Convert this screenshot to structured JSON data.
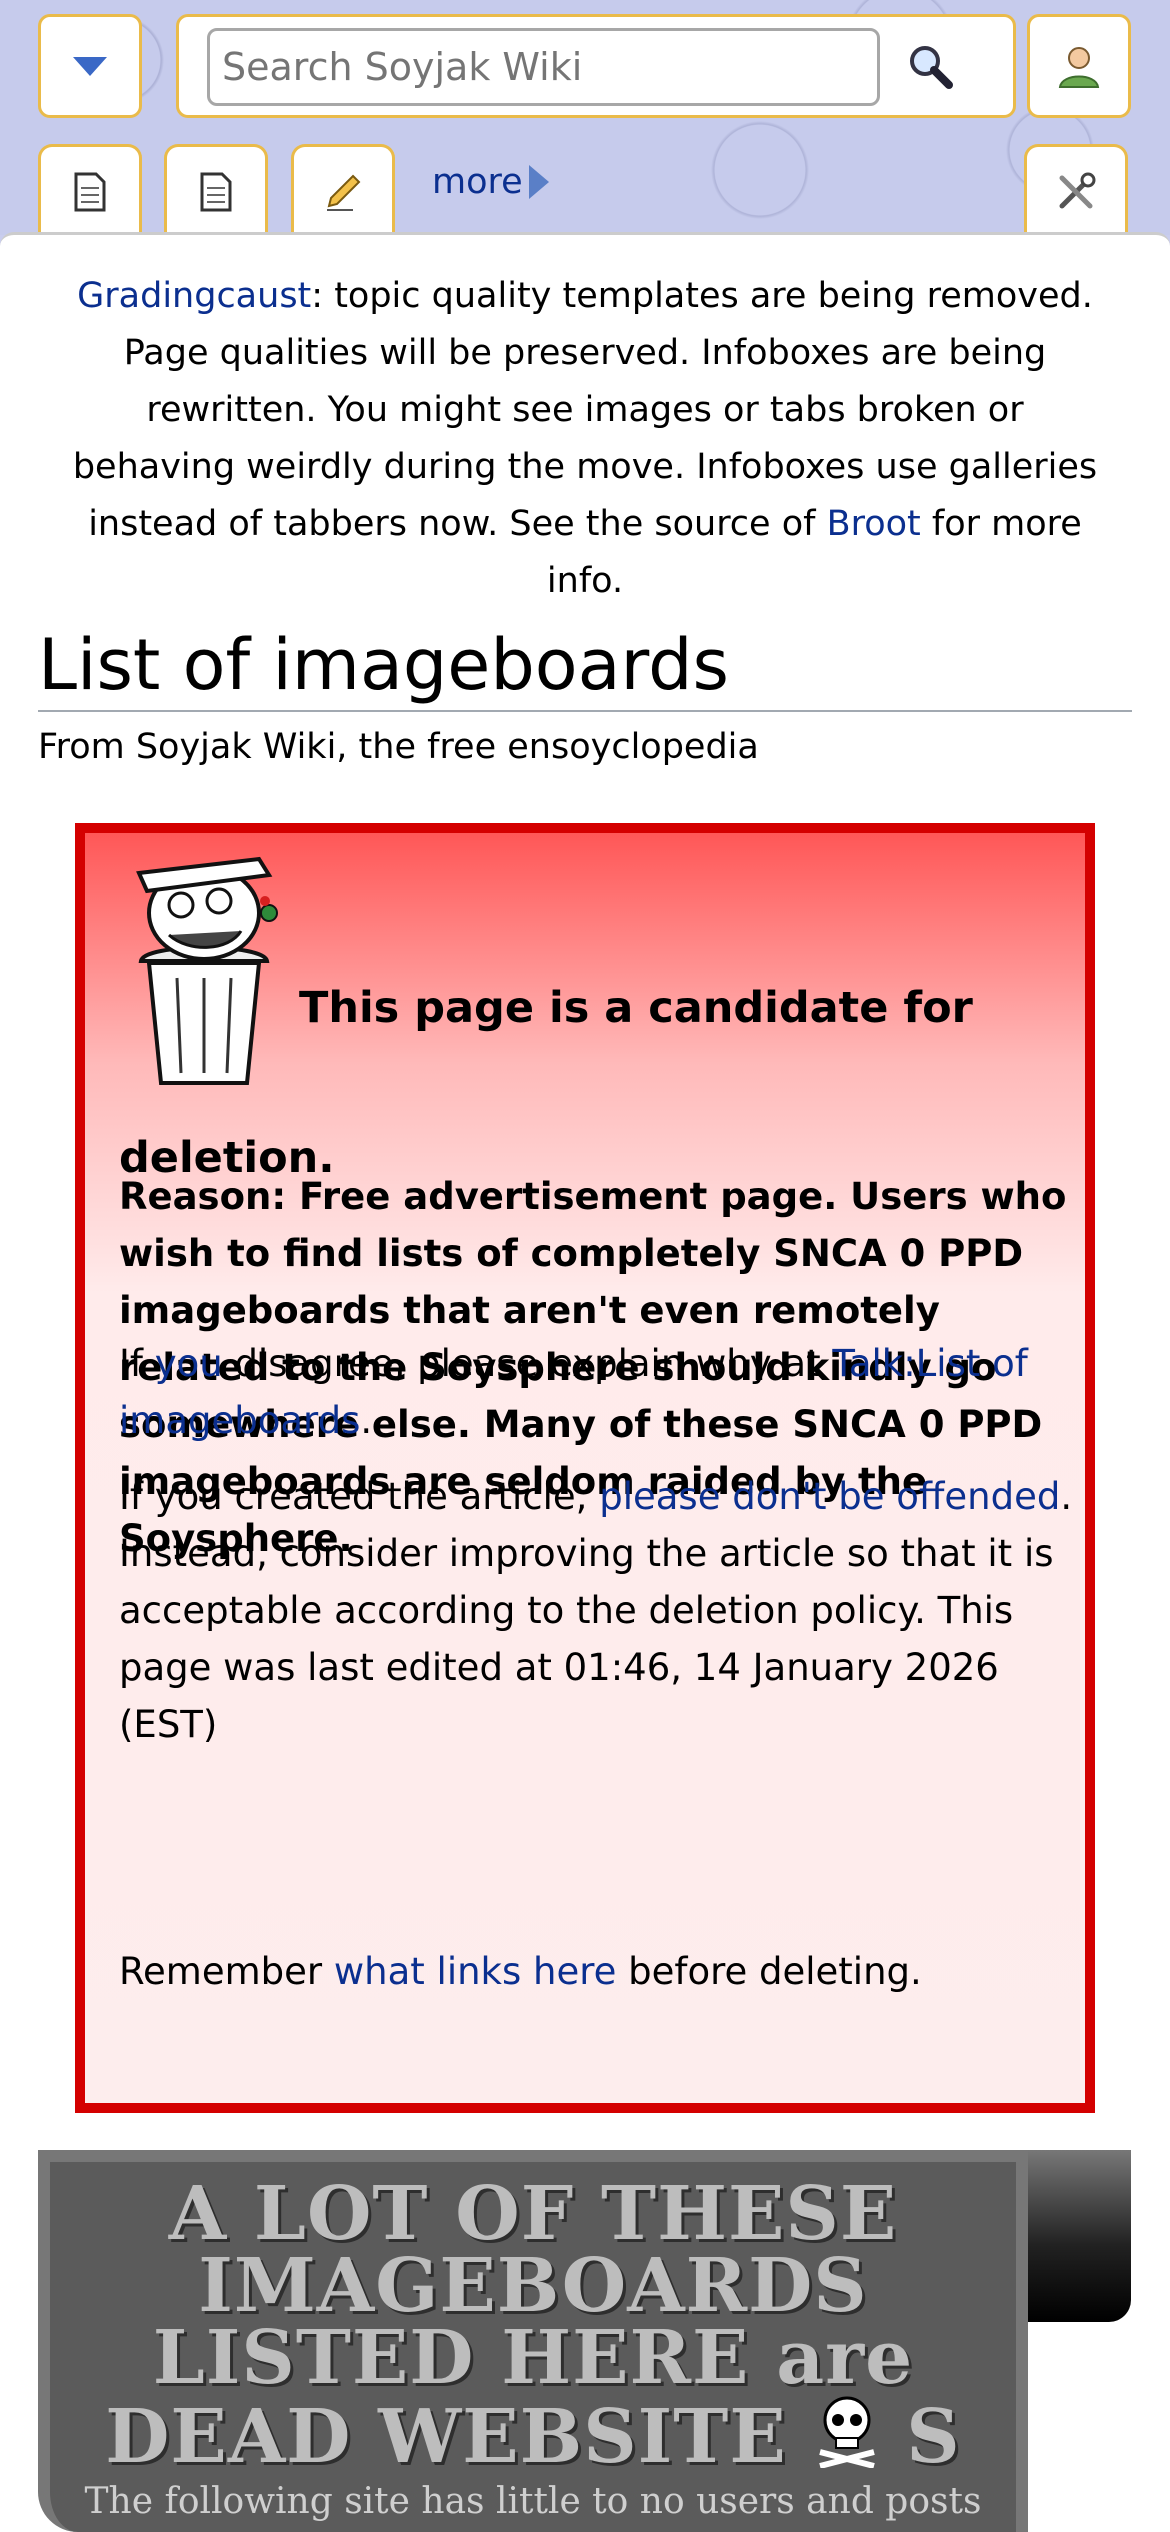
{
  "search": {
    "placeholder": "Search Soyjak Wiki"
  },
  "tabs": {
    "more_label": "more"
  },
  "sitenotice": {
    "link1": "Gradingcaust",
    "text1": ": topic quality templates are being removed. Page qualities will be preserved. Infoboxes are being rewritten. You might see images or tabs broken or behaving weirdly during the move. Infoboxes use galleries instead of tabbers now. See the source of ",
    "link2": "Broot",
    "text2": " for more info."
  },
  "page": {
    "title": "List of imageboards",
    "tagline": "From Soyjak Wiki, the free ensoyclopedia"
  },
  "deletion": {
    "heading_line1": "This page is a candidate for",
    "heading_line2": "deletion.",
    "reason": "Reason: Free advertisement page. Users who wish to find lists of completely SNCA 0 PPD imageboards that aren't even remotely related to the Soysphere should kindly go somewhere else. Many of these SNCA 0 PPD imageboards are seldom raided by the Soysphere.",
    "p1_a": "If ",
    "p1_link1": "you",
    "p1_b": " disagree, please explain why at ",
    "p1_link2": "Talk:List of imageboards",
    "p1_c": ".",
    "p2_a": "If you created the article, ",
    "p2_link": "please don't be offended",
    "p2_b": ". Instead, consider improving the article so that it is acceptable according to the deletion policy. This page was last edited at 01:46, 14 January 2026 (EST)",
    "p3_a": "Remember ",
    "p3_link": "what links here",
    "p3_b": " before deleting."
  },
  "banner": {
    "line1": "A LOT OF THESE",
    "line2": "IMAGEBOARDS",
    "line3": "LISTED HERE are",
    "line4a": "DEAD WEBSITE",
    "line4b": "S",
    "subtitle": "The following site has little to no users and posts"
  },
  "colors": {
    "accent_border": "#eabb4a",
    "link": "#0b2f8f",
    "alert_border": "#d40000"
  }
}
